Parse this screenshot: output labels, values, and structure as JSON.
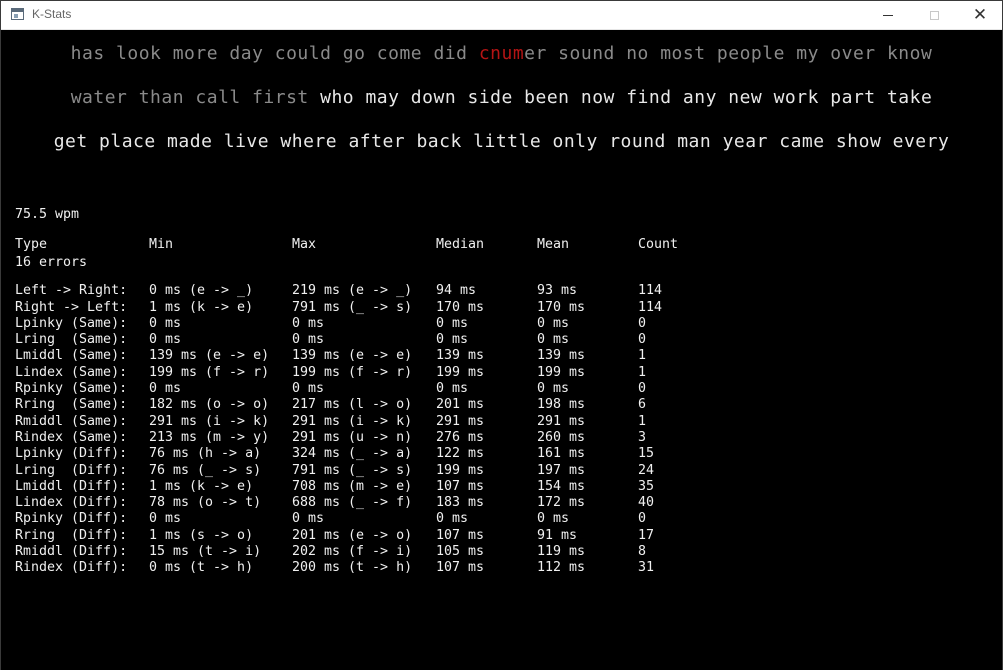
{
  "window": {
    "title": "K-Stats",
    "close_glyph": "✕"
  },
  "typing": {
    "lines": [
      [
        {
          "text": "has look more day could go come did ",
          "state": "done"
        },
        {
          "text": "cnum",
          "state": "error"
        },
        {
          "text": "er sound no most people my over know",
          "state": "done"
        }
      ],
      [
        {
          "text": "water than call first ",
          "state": "done"
        },
        {
          "text": "who may down side been now find any new work part take",
          "state": "pending"
        }
      ],
      [
        {
          "text": "get place made live where after back little only round man year came show every",
          "state": "pending"
        }
      ]
    ],
    "colors": {
      "done": "#8a8a8a",
      "error": "#b41414",
      "pending": "#e8e8e8"
    }
  },
  "summary": {
    "wpm": "75.5 wpm",
    "errors": "16 errors"
  },
  "table": {
    "headers": [
      "Type",
      "Min",
      "Max",
      "Median",
      "Mean",
      "Count"
    ],
    "rows": [
      [
        "Left -> Right:",
        "0 ms (e -> _)",
        "219 ms (e -> _)",
        "94 ms",
        "93 ms",
        "114"
      ],
      [
        "Right -> Left:",
        "1 ms (k -> e)",
        "791 ms (_ -> s)",
        "170 ms",
        "170 ms",
        "114"
      ],
      [
        "Lpinky (Same):",
        "0 ms",
        "0 ms",
        "0 ms",
        "0 ms",
        "0"
      ],
      [
        "Lring  (Same):",
        "0 ms",
        "0 ms",
        "0 ms",
        "0 ms",
        "0"
      ],
      [
        "Lmiddl (Same):",
        "139 ms (e -> e)",
        "139 ms (e -> e)",
        "139 ms",
        "139 ms",
        "1"
      ],
      [
        "Lindex (Same):",
        "199 ms (f -> r)",
        "199 ms (f -> r)",
        "199 ms",
        "199 ms",
        "1"
      ],
      [
        "Rpinky (Same):",
        "0 ms",
        "0 ms",
        "0 ms",
        "0 ms",
        "0"
      ],
      [
        "Rring  (Same):",
        "182 ms (o -> o)",
        "217 ms (l -> o)",
        "201 ms",
        "198 ms",
        "6"
      ],
      [
        "Rmiddl (Same):",
        "291 ms (i -> k)",
        "291 ms (i -> k)",
        "291 ms",
        "291 ms",
        "1"
      ],
      [
        "Rindex (Same):",
        "213 ms (m -> y)",
        "291 ms (u -> n)",
        "276 ms",
        "260 ms",
        "3"
      ],
      [
        "Lpinky (Diff):",
        "76 ms (h -> a)",
        "324 ms (_ -> a)",
        "122 ms",
        "161 ms",
        "15"
      ],
      [
        "Lring  (Diff):",
        "76 ms (_ -> s)",
        "791 ms (_ -> s)",
        "199 ms",
        "197 ms",
        "24"
      ],
      [
        "Lmiddl (Diff):",
        "1 ms (k -> e)",
        "708 ms (m -> e)",
        "107 ms",
        "154 ms",
        "35"
      ],
      [
        "Lindex (Diff):",
        "78 ms (o -> t)",
        "688 ms (_ -> f)",
        "183 ms",
        "172 ms",
        "40"
      ],
      [
        "Rpinky (Diff):",
        "0 ms",
        "0 ms",
        "0 ms",
        "0 ms",
        "0"
      ],
      [
        "Rring  (Diff):",
        "1 ms (s -> o)",
        "201 ms (e -> o)",
        "107 ms",
        "91 ms",
        "17"
      ],
      [
        "Rmiddl (Diff):",
        "15 ms (t -> i)",
        "202 ms (f -> i)",
        "105 ms",
        "119 ms",
        "8"
      ],
      [
        "Rindex (Diff):",
        "0 ms (t -> h)",
        "200 ms (t -> h)",
        "107 ms",
        "112 ms",
        "31"
      ]
    ]
  }
}
